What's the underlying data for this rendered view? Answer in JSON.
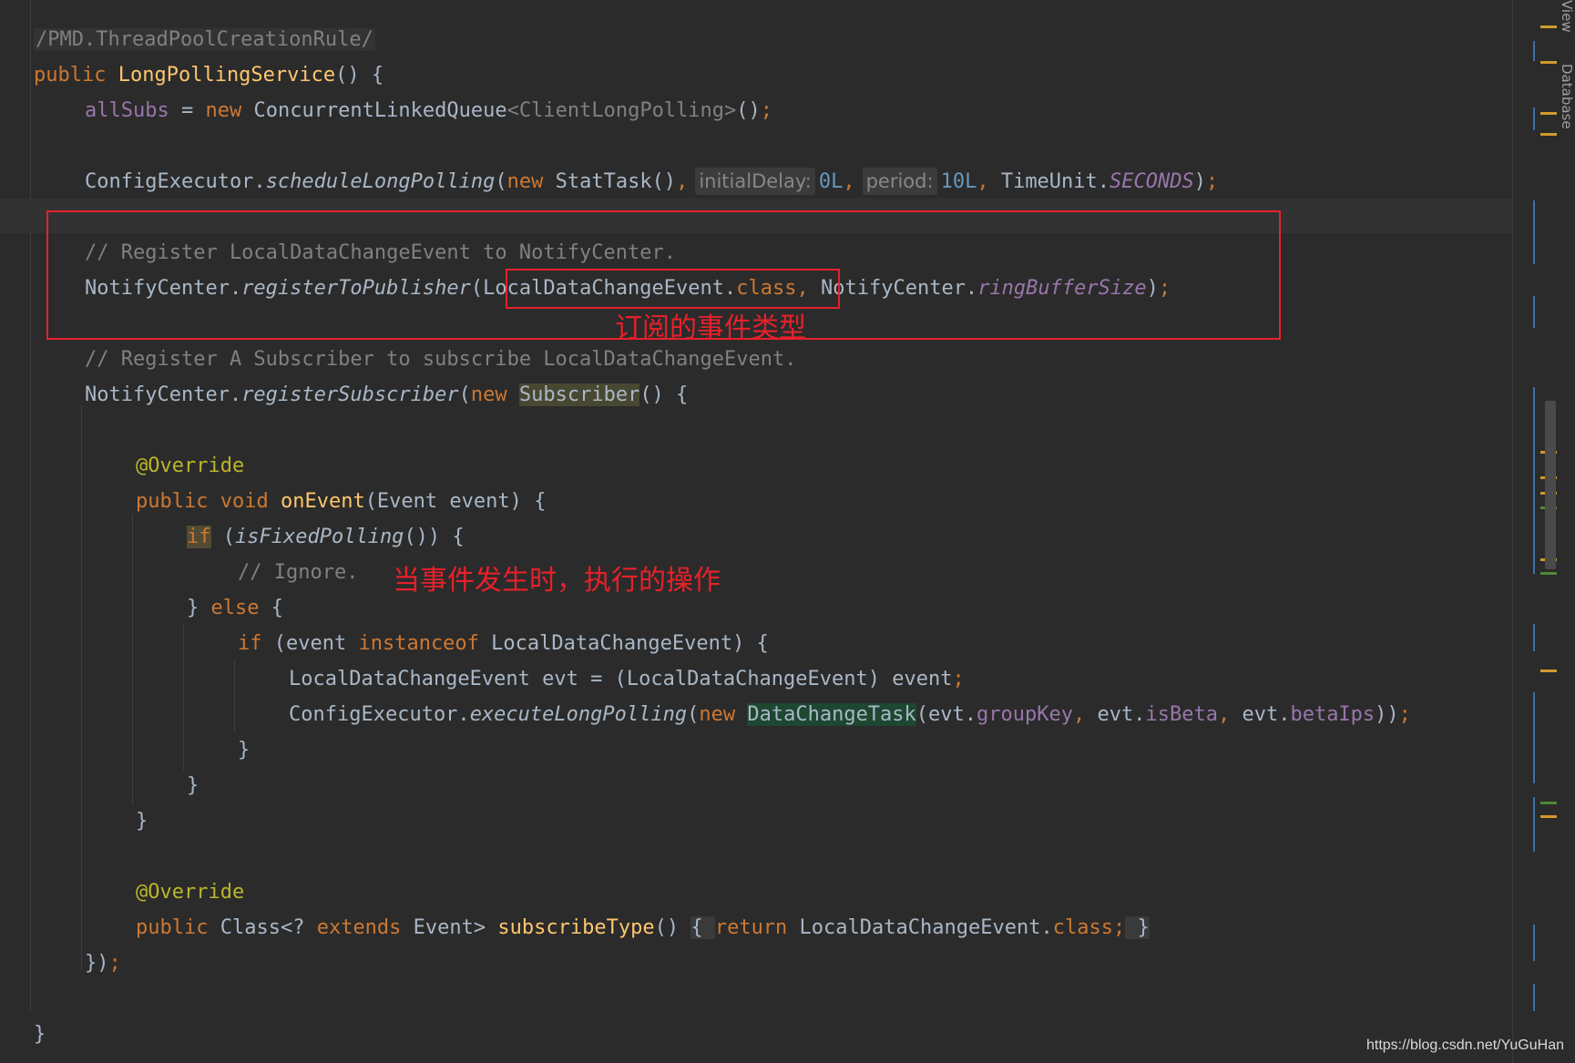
{
  "editor": {
    "lines": {
      "l0": "/PMD.ThreadPoolCreationRule/",
      "l1_kw": "public",
      "l1_fn": "LongPollingService",
      "l1_rest": "() {",
      "l2_field": "allSubs",
      "l2_eq": " = ",
      "l2_new": "new",
      "l2_type": " ConcurrentLinkedQueue",
      "l2_gen": "<ClientLongPolling>",
      "l2_rest": "()",
      "l2_semi": ";",
      "l4_obj": "ConfigExecutor.",
      "l4_method": "scheduleLongPolling",
      "l4_paren": "(",
      "l4_new": "new",
      "l4_call": " StatTask()",
      "l4_comma1": ",",
      "l4_hint1": "initialDelay:",
      "l4_val1": "0L",
      "l4_comma2": ",",
      "l4_hint2": "period:",
      "l4_val2": "10L",
      "l4_comma3": ",",
      "l4_unit": " TimeUnit.",
      "l4_const": "SECONDS",
      "l4_end": ")",
      "l4_semi": ";",
      "l6_comment": "// Register LocalDataChangeEvent to NotifyCenter.",
      "l7_obj": "NotifyCenter.",
      "l7_method": "registerToPublisher",
      "l7_paren": "(",
      "l7_class": "LocalDataChangeEvent.",
      "l7_kw": "class",
      "l7_comma": ",",
      "l7_obj2": " NotifyCenter.",
      "l7_field": "ringBufferSize",
      "l7_end": ")",
      "l7_semi": ";",
      "l9_comment": "// Register A Subscriber to subscribe LocalDataChangeEvent.",
      "l10_obj": "NotifyCenter.",
      "l10_method": "registerSubscriber",
      "l10_paren": "(",
      "l10_new": "new",
      "l10_sp": " ",
      "l10_type": "Subscriber",
      "l10_rest": "() {",
      "l12_ann": "@Override",
      "l13_kw1": "public",
      "l13_kw2": "void",
      "l13_fn": "onEvent",
      "l13_rest": "(Event event) {",
      "l14_if": "if",
      "l14_rest1": " (",
      "l14_call": "isFixedPolling",
      "l14_rest2": "()) {",
      "l15_comment": "// Ignore.",
      "l16_close": "} ",
      "l16_else": "else",
      "l16_open": " {",
      "l17_if": "if",
      "l17_a": " (event ",
      "l17_inst": "instanceof",
      "l17_b": " LocalDataChangeEvent) {",
      "l18_a": "LocalDataChangeEvent evt = (LocalDataChangeEvent) event",
      "l18_semi": ";",
      "l19_obj": "ConfigExecutor.",
      "l19_method": "executeLongPolling",
      "l19_paren": "(",
      "l19_new": "new",
      "l19_sp": " ",
      "l19_type": "DataChangeTask",
      "l19_a": "(evt.",
      "l19_f1": "groupKey",
      "l19_c1": ",",
      "l19_b": " evt.",
      "l19_f2": "isBeta",
      "l19_c2": ",",
      "l19_c": " evt.",
      "l19_f3": "betaIps",
      "l19_end": "))",
      "l19_semi": ";",
      "l20": "}",
      "l21": "}",
      "l22": "}",
      "l24_ann": "@Override",
      "l25_kw": "public",
      "l25_a": " Class<? ",
      "l25_ext": "extends",
      "l25_b": " Event> ",
      "l25_fn": "subscribeType",
      "l25_c": "() ",
      "l25_fold_open": "{ ",
      "l25_ret": "return",
      "l25_d": " LocalDataChangeEvent.",
      "l25_cls": "class",
      "l25_semi": ";",
      "l25_fold_close": " }",
      "l26_close": "})",
      "l26_semi": ";",
      "l28": "}"
    }
  },
  "annotations": {
    "event_type": "订阅的事件类型",
    "on_event": "当事件发生时，执行的操作"
  },
  "side_panel": {
    "tab_view": "View",
    "tab_database": "Database"
  },
  "watermark": "https://blog.csdn.net/YuGuHan",
  "colors": {
    "background": "#2b2b2b",
    "keyword": "#cc7832",
    "function": "#ffc66d",
    "field": "#9876aa",
    "number": "#6897bb",
    "comment": "#808080",
    "annotation": "#bbb529",
    "red_markup": "#e8202a"
  }
}
